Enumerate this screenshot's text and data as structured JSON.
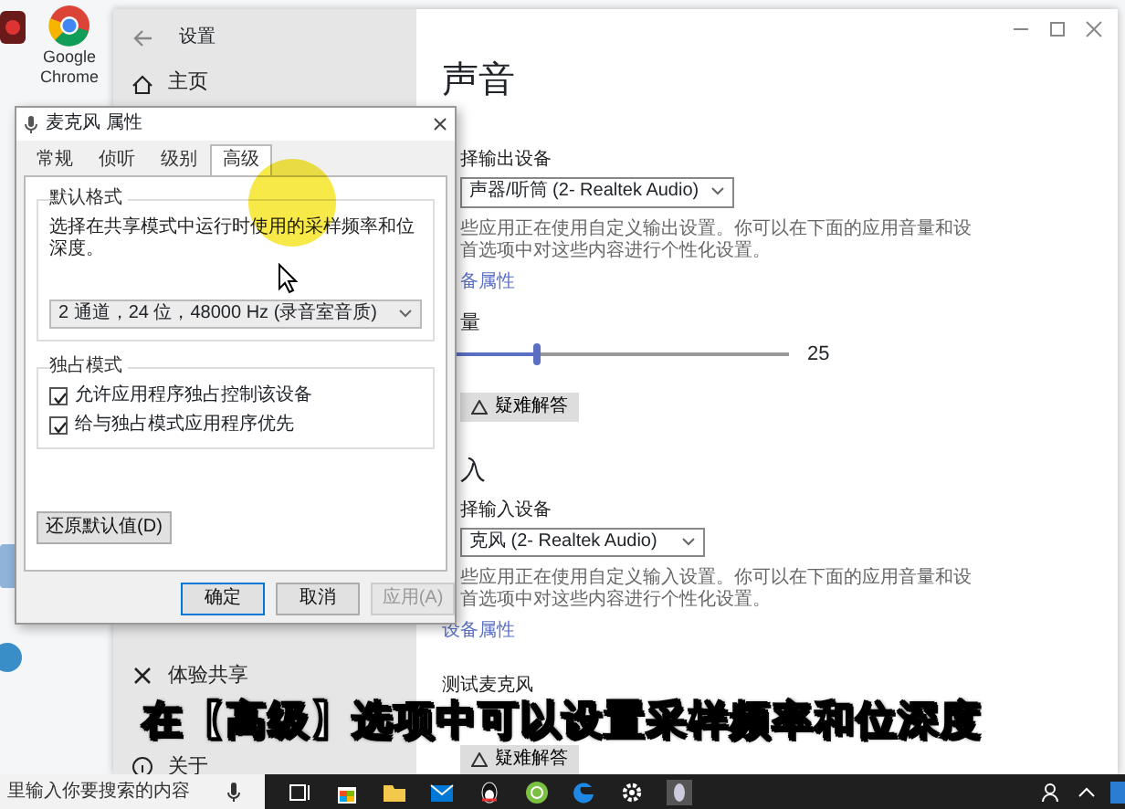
{
  "desktop": {
    "shortcut": {
      "label": "Google Chrome"
    }
  },
  "settings_window": {
    "title": "设置",
    "sidebar": {
      "items": [
        {
          "label": "主页"
        },
        {
          "label": "体验共享"
        },
        {
          "label": "关于"
        }
      ]
    },
    "page": {
      "title": "声音",
      "output": {
        "label": "择输出设备",
        "device": "声器/听筒 (2- Realtek Audio)",
        "description": [
          "些应用正在使用自定义输出设置。你可以在下面的应用音量和设",
          "首选项中对这些内容进行个性化设置。"
        ],
        "link": "备属性",
        "volume_label": "量",
        "volume": {
          "level": 0.25
        },
        "volume_value": "25",
        "troubleshoot": "疑难解答"
      },
      "input": {
        "heading": "入",
        "label": "择输入设备",
        "device": "克风 (2- Realtek Audio)",
        "description": [
          "些应用正在使用自定义输入设置。你可以在下面的应用音量和设",
          "首选项中对这些内容进行个性化设置。"
        ],
        "link": "设备属性",
        "test_label": "测试麦克风",
        "troubleshoot": "疑难解答"
      }
    }
  },
  "dialog": {
    "title": "麦克风 属性",
    "tabs": [
      {
        "label": "常规",
        "selected": false
      },
      {
        "label": "侦听",
        "selected": false
      },
      {
        "label": "级别",
        "selected": false
      },
      {
        "label": "高级",
        "selected": true
      }
    ],
    "default_format": {
      "heading": "默认格式",
      "description": "选择在共享模式中运行时使用的采样频率和位深度。",
      "format": "2 通道，24 位，48000 Hz (录音室音质)"
    },
    "exclusive_mode": {
      "heading": "独占模式",
      "options": [
        {
          "label": "允许应用程序独占控制该设备",
          "checked": true
        },
        {
          "label": "给与独占模式应用程序优先",
          "checked": true
        }
      ]
    },
    "restore_button": "还原默认值(D)",
    "buttons": [
      {
        "label": "确定",
        "kind": "default"
      },
      {
        "label": "取消",
        "kind": "normal"
      },
      {
        "label": "应用(A)",
        "kind": "disabled"
      }
    ]
  },
  "caption": "在【高级】选项中可以设置采样频率和位深度",
  "taskbar": {
    "search": {
      "placeholder": "里输入你要搜索的内容"
    }
  }
}
